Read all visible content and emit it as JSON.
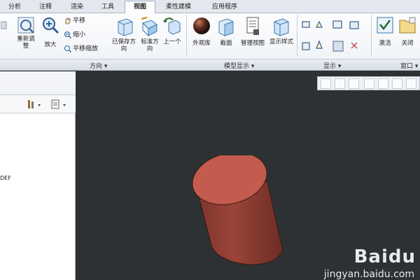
{
  "tabs": [
    {
      "label": "分析"
    },
    {
      "label": "注释"
    },
    {
      "label": "渲染"
    },
    {
      "label": "工具"
    },
    {
      "label": "视图"
    },
    {
      "label": "柔性建模"
    },
    {
      "label": "应用程序"
    }
  ],
  "ribbon": {
    "orientation": {
      "redefine_label": "重新调整",
      "zoom_in_label": "放大",
      "pan_label": "平移",
      "zoom_out_label": "缩小",
      "pan_zoom_label": "平移缩放",
      "saved_orient_label": "已保存方向",
      "std_orient_label": "标准方向",
      "prev_label": "上一个"
    },
    "model_display": {
      "appearance_label": "外观库",
      "section_label": "截面",
      "manage_views_label": "管理视图",
      "display_style_label": "显示样式"
    },
    "window": {
      "activate_label": "激活",
      "close_label": "关闭"
    }
  },
  "group_labels": {
    "orientation": "方向",
    "model_display": "模型显示",
    "show": "显示",
    "window": "窗口"
  },
  "left_panel": {
    "tree_item": "DEF"
  },
  "watermark": {
    "logo": "Baidu",
    "url": "jingyan.baidu.com"
  },
  "colors": {
    "viewport_bg": "#2d3133",
    "cylinder_top": "#c25c4f",
    "cylinder_side": "#8a3d33"
  }
}
